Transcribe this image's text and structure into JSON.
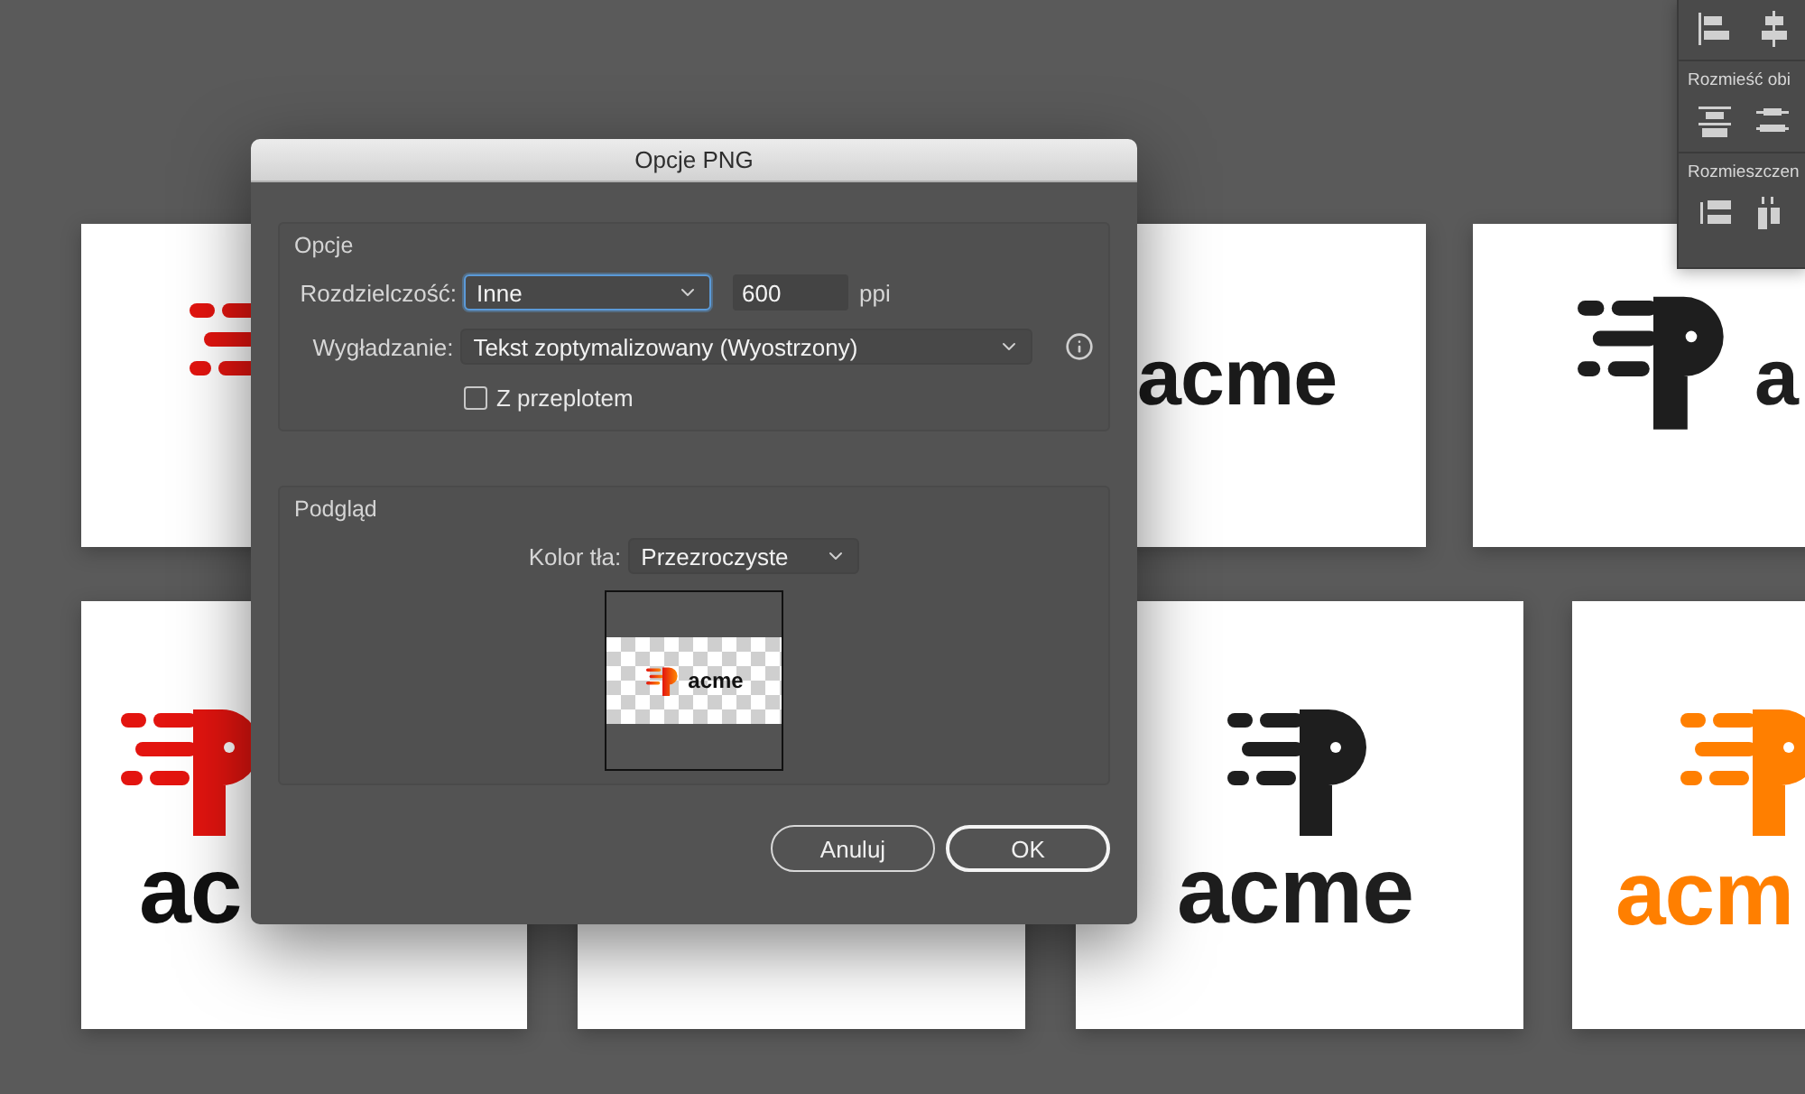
{
  "artboards": [
    {
      "logo": {
        "color": "#e3140f"
      }
    },
    {
      "wordmark": {
        "text": "acme",
        "color": "#1a1a1a"
      }
    },
    {
      "logo": {
        "color": "#1e1e1e"
      },
      "wordmark": {
        "text": "a",
        "color": "#1e1e1e"
      }
    },
    {
      "logo": {
        "color": "#e3140f"
      },
      "wordmark": {
        "text": "ac",
        "color": "#111111"
      }
    },
    {
      "logo": {
        "color": "#1e1e1e"
      },
      "wordmark": {
        "text": "acme",
        "color": "#1e1e1e"
      }
    },
    {
      "logo": {
        "color": "#ff7f00"
      },
      "wordmark": {
        "text": "acm",
        "color": "#ff7f00"
      }
    }
  ],
  "panel": {
    "headings": [
      "Rozmieść obi",
      "Rozmieszczen"
    ]
  },
  "dialog": {
    "title": "Opcje PNG",
    "options": {
      "title": "Opcje",
      "resolution": {
        "label": "Rozdzielczość:",
        "value": "Inne",
        "focused": true
      },
      "ppi": {
        "value": "600",
        "unit": "ppi"
      },
      "antialiasing": {
        "label": "Wygładzanie:",
        "value": "Tekst zoptymalizowany (Wyostrzony)"
      },
      "interlaced": {
        "label": "Z przeplotem",
        "checked": false
      }
    },
    "preview": {
      "title": "Podgląd",
      "background": {
        "label": "Kolor tła:",
        "value": "Przezroczyste"
      },
      "thumbnail": {
        "wordmark": "acme"
      }
    },
    "buttons": [
      {
        "label": "Anuluj",
        "default": false
      },
      {
        "label": "OK",
        "default": true
      }
    ]
  }
}
